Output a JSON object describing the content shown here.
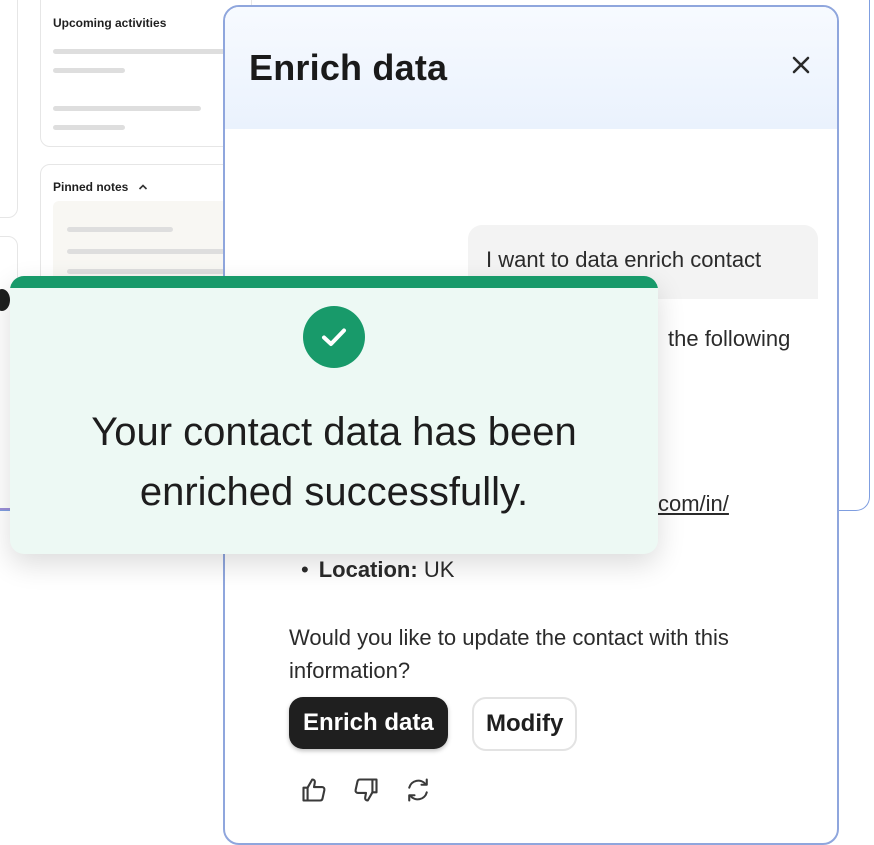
{
  "background": {
    "activities_title": "Upcoming activities",
    "notes_title": "Pinned notes",
    "notes_chevron_icon": "chevron-up-icon"
  },
  "panel": {
    "title": "Enrich data",
    "close_icon": "close-icon",
    "user_message": "I want to data enrich contact",
    "response_partial_1": "the following",
    "response_partial_2": "com/in/",
    "location_label": "Location:",
    "location_value": "UK",
    "question": "Would you like to update the contact with this information?",
    "primary_button": "Enrich data",
    "secondary_button": "Modify",
    "feedback_icons": [
      "thumbs-up-icon",
      "thumbs-down-icon",
      "refresh-icon"
    ]
  },
  "toast": {
    "icon": "check-circle-icon",
    "message_line1": "Your contact data has been",
    "message_line2": "enriched successfully."
  },
  "colors": {
    "success": "#189a6a",
    "toast_bg": "#edf9f4",
    "panel_border": "#8fa6dd",
    "primary_button": "#1f1f1f"
  }
}
